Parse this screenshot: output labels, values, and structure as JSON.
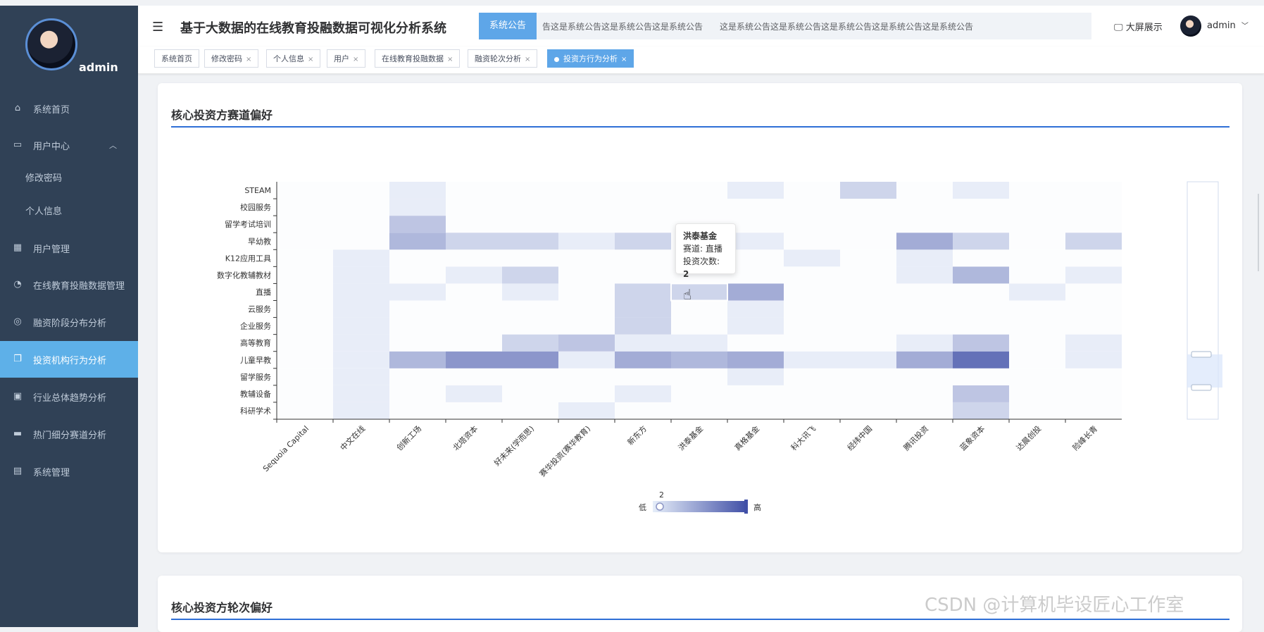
{
  "sidebar": {
    "username": "admin",
    "items": [
      {
        "label": "系统首页",
        "icon": "home-icon"
      },
      {
        "label": "用户中心",
        "icon": "user-center-icon",
        "expanded": true
      },
      {
        "label": "修改密码",
        "sub": true
      },
      {
        "label": "个人信息",
        "sub": true
      },
      {
        "label": "用户管理",
        "icon": "grid-icon"
      },
      {
        "label": "在线教育投融数据管理",
        "icon": "dashboard-icon"
      },
      {
        "label": "融资阶段分布分析",
        "icon": "ring-icon"
      },
      {
        "label": "投资机构行为分析",
        "icon": "copy-icon",
        "active": true
      },
      {
        "label": "行业总体趋势分析",
        "icon": "clipboard-icon"
      },
      {
        "label": "热门细分赛道分析",
        "icon": "briefcase-icon"
      },
      {
        "label": "系统管理",
        "icon": "message-icon"
      }
    ]
  },
  "header": {
    "title": "基于大数据的在线教育投融数据可视化分析系统",
    "notice_label": "系统公告",
    "notice_text": "告这是系统公告这是系统公告这是系统公告　　这是系统公告这是系统公告这是系统公告这是系统公告这是系统公告",
    "bigscreen_label": "大屏展示",
    "user_label": "admin"
  },
  "tags": [
    {
      "label": "系统首页",
      "closable": false
    },
    {
      "label": "修改密码",
      "closable": true
    },
    {
      "label": "个人信息",
      "closable": true
    },
    {
      "label": "用户",
      "closable": true
    },
    {
      "label": "在线教育投融数据",
      "closable": true
    },
    {
      "label": "融资轮次分析",
      "closable": true
    },
    {
      "label": "投资方行为分析",
      "closable": true,
      "active": true
    }
  ],
  "cards": {
    "card1_title": "核心投资方赛道偏好",
    "card2_title": "核心投资方轮次偏好"
  },
  "chart_data": {
    "type": "heatmap",
    "title": "",
    "x": [
      "Sequoia Capital",
      "中文在线",
      "创新工场",
      "北塔资本",
      "好未来(学而思)",
      "赛华投资(赛华教育)",
      "新东方",
      "洪泰基金",
      "真格基金",
      "科大讯飞",
      "经纬中国",
      "腾讯投资",
      "蓝象资本",
      "达晨创投",
      "险峰长青"
    ],
    "y": [
      "科研学术",
      "教辅设备",
      "留学服务",
      "儿童早教",
      "高等教育",
      "企业服务",
      "云服务",
      "直播",
      "数字化教辅教材",
      "K12应用工具",
      "早幼教",
      "留学考试培训",
      "校园服务",
      "STEAM"
    ],
    "values": [
      [
        0,
        1,
        0,
        0,
        0,
        1,
        0,
        0,
        0,
        0,
        0,
        0,
        2,
        0,
        0
      ],
      [
        0,
        1,
        0,
        1,
        0,
        0,
        1,
        0,
        0,
        0,
        0,
        0,
        3,
        0,
        0
      ],
      [
        0,
        1,
        0,
        0,
        0,
        0,
        0,
        0,
        1,
        0,
        0,
        0,
        0,
        0,
        0
      ],
      [
        0,
        1,
        4,
        7,
        7,
        1,
        5,
        4,
        5,
        1,
        1,
        5,
        11,
        0,
        1
      ],
      [
        0,
        1,
        0,
        0,
        2,
        3,
        1,
        1,
        0,
        0,
        0,
        1,
        3,
        0,
        1
      ],
      [
        0,
        1,
        0,
        0,
        0,
        0,
        2,
        0,
        1,
        0,
        0,
        0,
        0,
        0,
        0
      ],
      [
        0,
        1,
        0,
        0,
        0,
        0,
        2,
        0,
        1,
        0,
        0,
        0,
        0,
        0,
        0
      ],
      [
        0,
        1,
        1,
        0,
        1,
        0,
        2,
        2,
        5,
        0,
        0,
        0,
        0,
        1,
        0
      ],
      [
        0,
        1,
        0,
        1,
        2,
        0,
        0,
        0,
        0,
        0,
        0,
        1,
        4,
        0,
        1
      ],
      [
        0,
        1,
        0,
        0,
        0,
        0,
        0,
        0,
        0,
        1,
        0,
        1,
        0,
        0,
        0
      ],
      [
        0,
        0,
        4,
        2,
        2,
        1,
        2,
        0,
        1,
        0,
        0,
        5,
        2,
        0,
        2
      ],
      [
        0,
        0,
        3,
        0,
        0,
        0,
        0,
        0,
        0,
        0,
        0,
        0,
        0,
        0,
        0
      ],
      [
        0,
        0,
        1,
        0,
        0,
        0,
        0,
        0,
        0,
        0,
        0,
        0,
        0,
        0,
        0
      ],
      [
        0,
        0,
        1,
        0,
        0,
        0,
        0,
        0,
        1,
        0,
        2,
        0,
        1,
        0,
        0
      ]
    ],
    "visual_map": {
      "min": 1,
      "max": 15,
      "selected_min": 2,
      "low_label": "低",
      "high_label": "高"
    },
    "color_low": "#f7fbff",
    "color_high": "#4150a7",
    "tooltip": {
      "investor": "洪泰基金",
      "track_label": "赛道: 直播",
      "count_label": "投资次数: ",
      "count": "2"
    }
  },
  "watermark": "CSDN @计算机毕设匠心工作室"
}
